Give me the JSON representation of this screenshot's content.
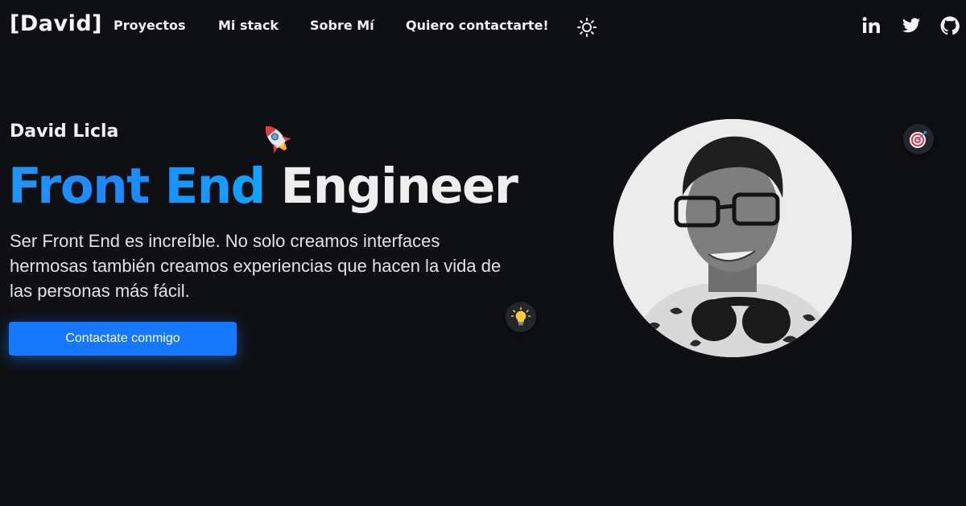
{
  "nav": {
    "logo": "[David]",
    "links": [
      {
        "label": "Proyectos"
      },
      {
        "label": "Mi stack"
      },
      {
        "label": "Sobre Mí"
      },
      {
        "label": "Quiero contactarte!"
      }
    ],
    "theme_icon": "sun-icon",
    "social": [
      {
        "icon": "linkedin-icon"
      },
      {
        "icon": "twitter-icon"
      },
      {
        "icon": "github-icon"
      }
    ]
  },
  "hero": {
    "name": "David Licla",
    "title_accent": "Front End",
    "title_rest": " Engineer",
    "description": "Ser Front End es increíble. No solo creamos interfaces hermosas también creamos experiencias que hacen la vida de las personas más fácil.",
    "cta_label": "Contactate conmigo",
    "decorations": [
      "rocket-icon",
      "lightbulb-icon",
      "target-icon"
    ]
  },
  "colors": {
    "background": "#0f1013",
    "accent": "#1677ff",
    "text": "#f2f2f2"
  }
}
